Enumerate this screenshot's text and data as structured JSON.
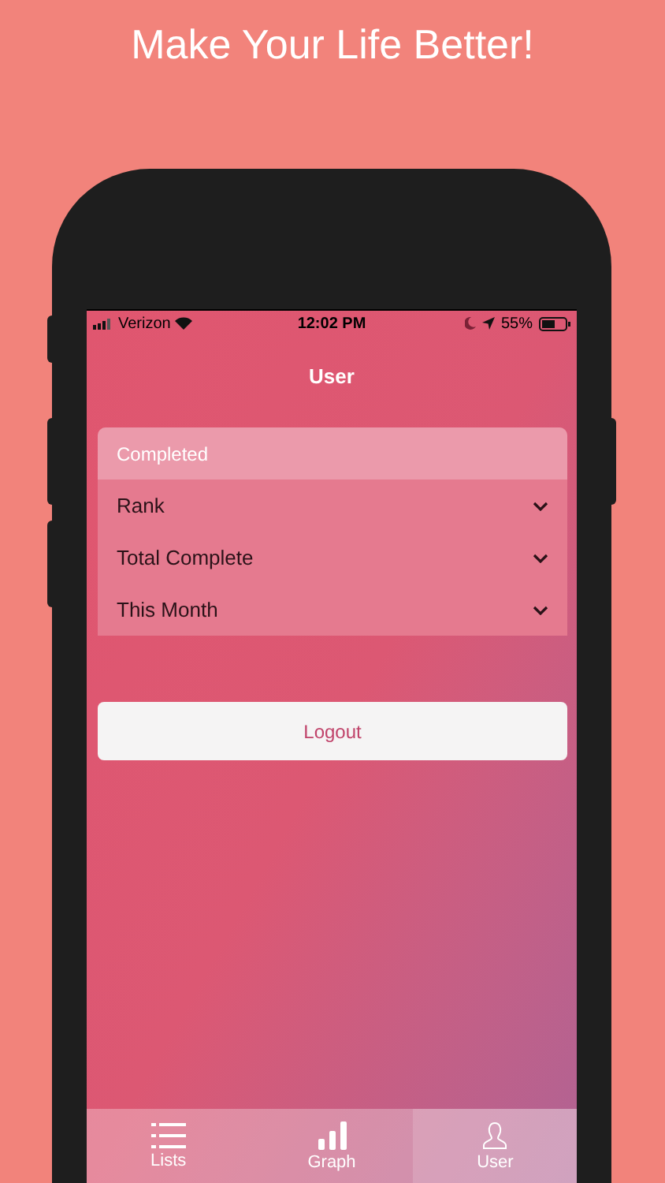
{
  "headline": "Make Your Life Better!",
  "status_bar": {
    "carrier": "Verizon",
    "time": "12:02 PM",
    "battery": "55%"
  },
  "nav": {
    "title": "User"
  },
  "stats": {
    "header": "Completed",
    "rows": [
      {
        "label": "Rank",
        "expanded": false
      },
      {
        "label": "Total Complete",
        "expanded": false
      },
      {
        "label": "This Month",
        "expanded": false
      }
    ]
  },
  "logout": {
    "label": "Logout"
  },
  "tabs": [
    {
      "kind": "list",
      "label": "Lists",
      "selected": false
    },
    {
      "kind": "graph",
      "label": "Graph",
      "selected": false
    },
    {
      "kind": "user",
      "label": "User",
      "selected": true
    }
  ]
}
